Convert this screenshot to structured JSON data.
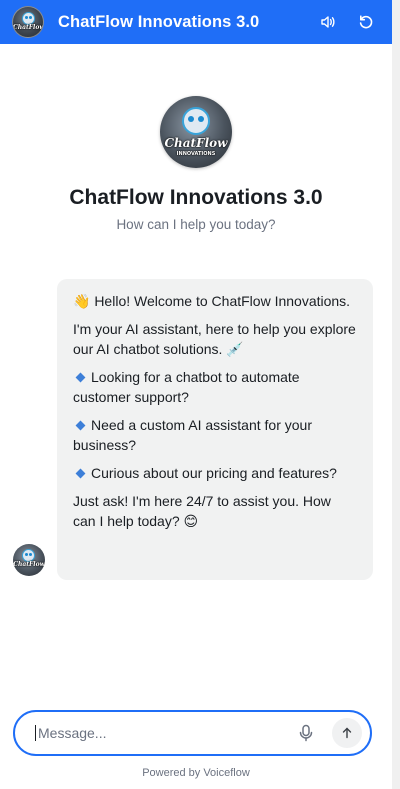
{
  "header": {
    "title": "ChatFlow Innovations 3.0",
    "color": "#1f6ef7"
  },
  "intro": {
    "title": "ChatFlow Innovations 3.0",
    "subtitle": "How can I help you today?"
  },
  "avatar": {
    "logo_text": "ChatFlow",
    "logo_subtext": "INNOVATIONS"
  },
  "message": {
    "greeting": "👋 Hello! Welcome to ChatFlow Innovations.",
    "intro": "I'm your AI assistant, here to help you explore our AI chatbot solutions. 💉",
    "bullets": [
      "Looking for a chatbot to automate customer support?",
      "Need a custom AI assistant for your business?",
      "Curious about our pricing and features?"
    ],
    "closing": "Just ask! I'm here 24/7 to assist you. How can I help today? 😊"
  },
  "composer": {
    "placeholder": "Message..."
  },
  "footer": {
    "powered_by": "Powered by Voiceflow"
  },
  "icons": {
    "sound": "speaker-icon",
    "reset": "refresh-icon",
    "mic": "microphone-icon",
    "send": "arrow-up-icon",
    "bullet": "blue-diamond-icon"
  }
}
